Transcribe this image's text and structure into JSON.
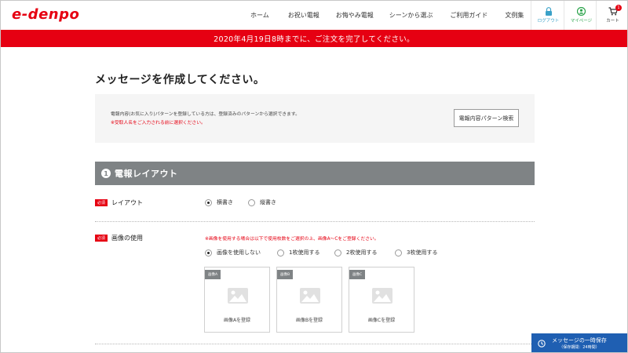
{
  "header": {
    "logo": "e-denpo",
    "nav": [
      "ホーム",
      "お祝い電報",
      "お悔やみ電報",
      "シーンから選ぶ",
      "ご利用ガイド",
      "文例集"
    ],
    "logout_label": "ログアウト",
    "mypage_label": "マイページ",
    "cart_label": "カート",
    "cart_count": "1"
  },
  "notice": "2020年4月19日8時までに、ご注文を完了してください。",
  "page_title": "メッセージを作成してください。",
  "info": {
    "text": "電報内容(お気に入り)パターンを登録している方は、登録済みのパターンから選択できます。",
    "warning": "※受取人名をご入力される前に選択ください。",
    "search_button": "電報内容パターン検索"
  },
  "section": {
    "number": "1",
    "title": "電報レイアウト"
  },
  "layout_row": {
    "required": "必須",
    "label": "レイアウト",
    "options": [
      "横書き",
      "縦書き"
    ],
    "selected": "横書き"
  },
  "image_row": {
    "required": "必須",
    "label": "画像の使用",
    "note": "※画像を使用する場合は以下で使用枚数をご選択の上、画像A～Cをご登録ください。",
    "options": [
      "画像を使用しない",
      "1枚使用する",
      "2枚使用する",
      "3枚使用する"
    ],
    "selected": "画像を使用しない",
    "cards": [
      {
        "tag": "画像A",
        "caption": "画像Aを登録"
      },
      {
        "tag": "画像B",
        "caption": "画像Bを登録"
      },
      {
        "tag": "画像C",
        "caption": "画像Cを登録"
      }
    ]
  },
  "save": {
    "label": "メッセージの一時保存",
    "sub": "（保存期間：24時間）"
  },
  "colors": {
    "brand_red": "#e60012",
    "section_gray": "#7f8385",
    "save_blue": "#1f5fb2"
  }
}
